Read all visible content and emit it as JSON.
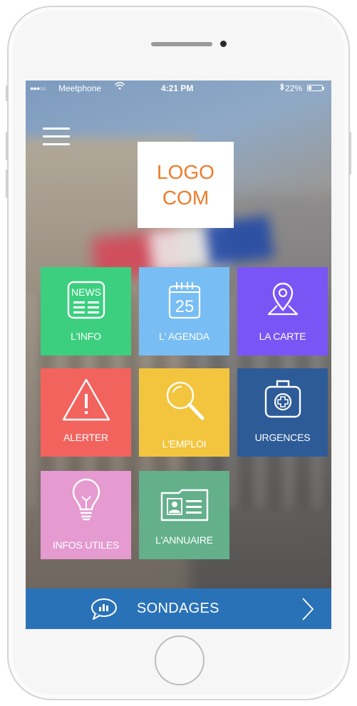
{
  "status_bar": {
    "signal": "●●●○○",
    "carrier": "Meetphone",
    "time": "4:21 PM",
    "bluetooth": "✱",
    "battery_percent": "22%",
    "battery_level": 0.22
  },
  "logo": {
    "line1": "LOGO",
    "line2": "COM"
  },
  "tiles": [
    {
      "label": "L'INFO",
      "icon_name": "news-icon",
      "color": "#3ccf7f",
      "icon_text": "NEWS"
    },
    {
      "label": "L' AGENDA",
      "icon_name": "calendar-icon",
      "color": "#78bdf4",
      "icon_text": "25"
    },
    {
      "label": "LA CARTE",
      "icon_name": "map-pin-icon",
      "color": "#7a55f6"
    },
    {
      "label": "ALERTER",
      "icon_name": "warning-icon",
      "color": "#f2635e"
    },
    {
      "label": "L'EMPLOI",
      "icon_name": "magnifier-icon",
      "color": "#f3c53e"
    },
    {
      "label": "URGENCES",
      "icon_name": "first-aid-kit-icon",
      "color": "#2d5b98"
    },
    {
      "label": "INFOS UTILES",
      "icon_name": "lightbulb-icon",
      "color": "#e59ad0"
    },
    {
      "label": "L'ANNUAIRE",
      "icon_name": "contact-card-icon",
      "color": "#63b08b"
    }
  ],
  "sondages": {
    "label": "SONDAGES",
    "color": "#2a72b8"
  }
}
